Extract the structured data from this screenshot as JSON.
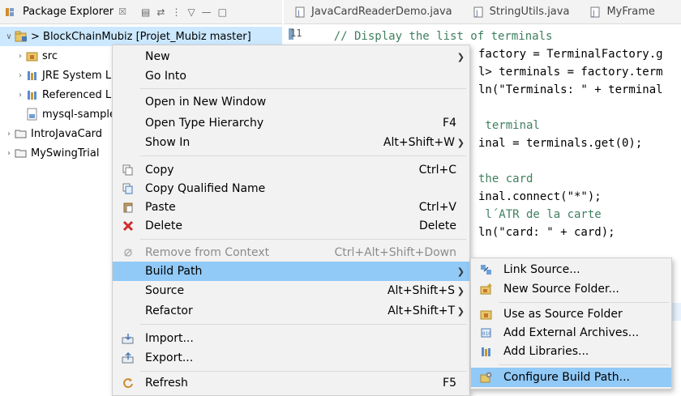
{
  "package_explorer": {
    "title": "Package Explorer",
    "close_glyph": "☒",
    "tree": [
      {
        "label": "> BlockChainMubiz [Projet_Mubiz master]",
        "icon": "project-icon",
        "expanded": true,
        "selected": true
      },
      {
        "label": "src",
        "icon": "package-folder-icon"
      },
      {
        "label": "JRE System Library",
        "icon": "library-icon"
      },
      {
        "label": "Referenced Libraries",
        "icon": "library-icon"
      },
      {
        "label": "mysql-sample",
        "icon": "jar-file-icon"
      },
      {
        "label": "IntroJavaCard",
        "icon": "folder-icon"
      },
      {
        "label": "MySwingTrial",
        "icon": "folder-icon"
      }
    ]
  },
  "editor": {
    "tabs": [
      {
        "label": "JavaCardReaderDemo.java",
        "icon": "java-file-icon"
      },
      {
        "label": "StringUtils.java",
        "icon": "java-file-icon"
      },
      {
        "label": "MyFrame",
        "icon": "java-file-icon"
      }
    ],
    "line_number": "11",
    "code_lines": [
      {
        "text": "    // Display the list of terminals",
        "kind": "comment"
      },
      {
        "text": "factory = TerminalFactory.g",
        "kind": "plain"
      },
      {
        "text": "l> terminals = factory.term",
        "kind": "plain"
      },
      {
        "text": "ln(\"Terminals: \" + terminal",
        "kind": "mixed"
      },
      {
        "text": " terminal",
        "kind": "comment"
      },
      {
        "text": "inal = terminals.get(0);",
        "kind": "plain"
      },
      {
        "text": "the card",
        "kind": "comment"
      },
      {
        "text": "inal.connect(\"*\");",
        "kind": "plain"
      },
      {
        "text": " l´ATR de la carte",
        "kind": "comment"
      },
      {
        "text": "ln(\"card: \" + card);",
        "kind": "mixed"
      }
    ]
  },
  "context_menu": {
    "items": [
      {
        "label": "New",
        "submenu": true
      },
      {
        "label": "Go Into"
      },
      {
        "sep": true
      },
      {
        "label": "Open in New Window"
      },
      {
        "label": "Open Type Hierarchy",
        "shortcut": "F4"
      },
      {
        "label": "Show In",
        "shortcut": "Alt+Shift+W",
        "submenu": true
      },
      {
        "sep": true
      },
      {
        "label": "Copy",
        "shortcut": "Ctrl+C",
        "icon": "copy-icon"
      },
      {
        "label": "Copy Qualified Name",
        "icon": "copy-qualified-icon"
      },
      {
        "label": "Paste",
        "shortcut": "Ctrl+V",
        "icon": "paste-icon"
      },
      {
        "label": "Delete",
        "shortcut": "Delete",
        "icon": "delete-icon"
      },
      {
        "sep": true
      },
      {
        "label": "Remove from Context",
        "shortcut": "Ctrl+Alt+Shift+Down",
        "icon": "remove-context-icon",
        "disabled": true
      },
      {
        "label": "Build Path",
        "submenu": true,
        "active": true
      },
      {
        "label": "Source",
        "shortcut": "Alt+Shift+S",
        "submenu": true
      },
      {
        "label": "Refactor",
        "shortcut": "Alt+Shift+T",
        "submenu": true
      },
      {
        "sep": true
      },
      {
        "label": "Import...",
        "icon": "import-icon"
      },
      {
        "label": "Export...",
        "icon": "export-icon"
      },
      {
        "sep": true
      },
      {
        "label": "Refresh",
        "shortcut": "F5",
        "icon": "refresh-icon"
      }
    ]
  },
  "build_path_submenu": {
    "items": [
      {
        "label": "Link Source...",
        "icon": "link-source-icon"
      },
      {
        "label": "New Source Folder...",
        "icon": "new-source-folder-icon"
      },
      {
        "sep": true
      },
      {
        "label": "Use as Source Folder",
        "icon": "source-folder-icon"
      },
      {
        "label": "Add External Archives...",
        "icon": "jar-add-icon"
      },
      {
        "label": "Add Libraries...",
        "icon": "library-icon"
      },
      {
        "sep": true
      },
      {
        "label": "Configure Build Path...",
        "icon": "configure-build-path-icon",
        "active": true
      }
    ]
  },
  "colors": {
    "selection": "#cce8ff",
    "menu_hover": "#91c9f7",
    "comment": "#3f7f5f",
    "string": "#2a00ff"
  }
}
